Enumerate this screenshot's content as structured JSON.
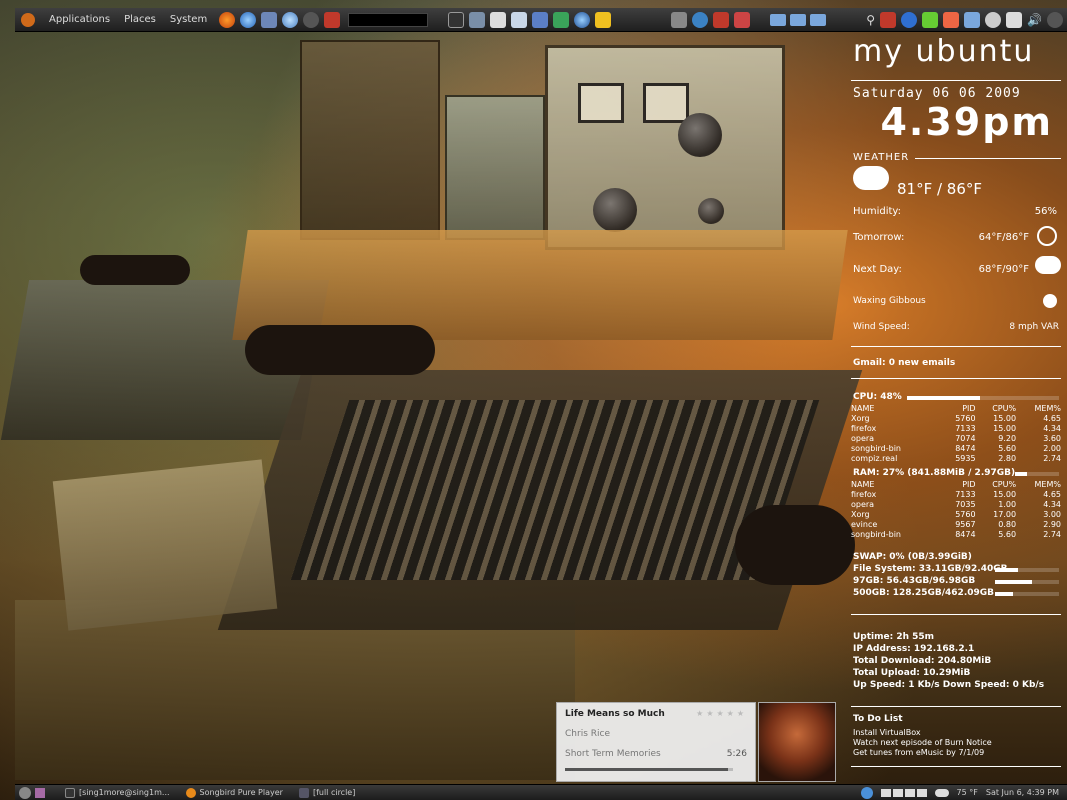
{
  "top_panel": {
    "menu": [
      "Applications",
      "Places",
      "System"
    ]
  },
  "conky": {
    "brand": "my ubuntu",
    "date": "Saturday 06 06 2009",
    "time": "4.39pm",
    "weather_header": "WEATHER",
    "current_temp": "81°F / 86°F",
    "humidity_label": "Humidity:",
    "humidity_value": "56%",
    "tomorrow_label": "Tomorrow:",
    "tomorrow_value": "64°F/86°F",
    "nextday_label": "Next Day:",
    "nextday_value": "68°F/90°F",
    "moon_label": "Waxing Gibbous",
    "wind_label": "Wind Speed:",
    "wind_value": "8 mph VAR",
    "gmail": "Gmail: 0 new emails",
    "cpu_label": "CPU: 48%",
    "cpu_percent": 48,
    "cpu_table_header": [
      "NAME",
      "PID",
      "CPU%",
      "MEM%"
    ],
    "cpu_table": [
      [
        "Xorg",
        "5760",
        "15.00",
        "4.65"
      ],
      [
        "firefox",
        "7133",
        "15.00",
        "4.34"
      ],
      [
        "opera",
        "7074",
        "9.20",
        "3.60"
      ],
      [
        "songbird-bin",
        "8474",
        "5.60",
        "2.00"
      ],
      [
        "compiz.real",
        "5935",
        "2.80",
        "2.74"
      ]
    ],
    "ram_label": "RAM: 27% (841.88MiB / 2.97GB)",
    "ram_percent": 27,
    "mem_table_header": [
      "NAME",
      "PID",
      "CPU%",
      "MEM%"
    ],
    "mem_table": [
      [
        "firefox",
        "7133",
        "15.00",
        "4.65"
      ],
      [
        "opera",
        "7035",
        "1.00",
        "4.34"
      ],
      [
        "Xorg",
        "5760",
        "17.00",
        "3.00"
      ],
      [
        "evince",
        "9567",
        "0.80",
        "2.90"
      ],
      [
        "songbird-bin",
        "8474",
        "5.60",
        "2.74"
      ]
    ],
    "swap_label": "SWAP: 0% (0B/3.99GiB)",
    "fs_label": "File System: 33.11GB/92.40GB",
    "fs_percent": 36,
    "drive97_label": "97GB: 56.43GB/96.98GB",
    "drive97_percent": 58,
    "drive500_label": "500GB: 128.25GB/462.09GB",
    "drive500_percent": 28,
    "uptime": "Uptime: 2h 55m",
    "ip": "IP Address: 192.168.2.1",
    "download": "Total Download: 204.80MiB",
    "upload": "Total Upload: 10.29MiB",
    "speed": "Up Speed: 1 Kb/s Down Speed: 0 Kb/s",
    "todo_header": "To Do List",
    "todo": [
      "Install VirtualBox",
      "Watch next episode of Burn Notice",
      "Get tunes from eMusic by 7/1/09"
    ]
  },
  "player": {
    "title": "Life Means so Much",
    "artist": "Chris Rice",
    "album": "Short Term Memories",
    "time": "5:26",
    "progress": 0.97
  },
  "bottom_panel": {
    "tasks": [
      "[sing1more@sing1m...",
      "Songbird Pure Player",
      "[full circle]"
    ],
    "temp": "75 °F",
    "clock": "Sat Jun 6, 4:39 PM"
  },
  "colors": {
    "panel": "#2b2b2b",
    "accent": "#d06a1a"
  }
}
